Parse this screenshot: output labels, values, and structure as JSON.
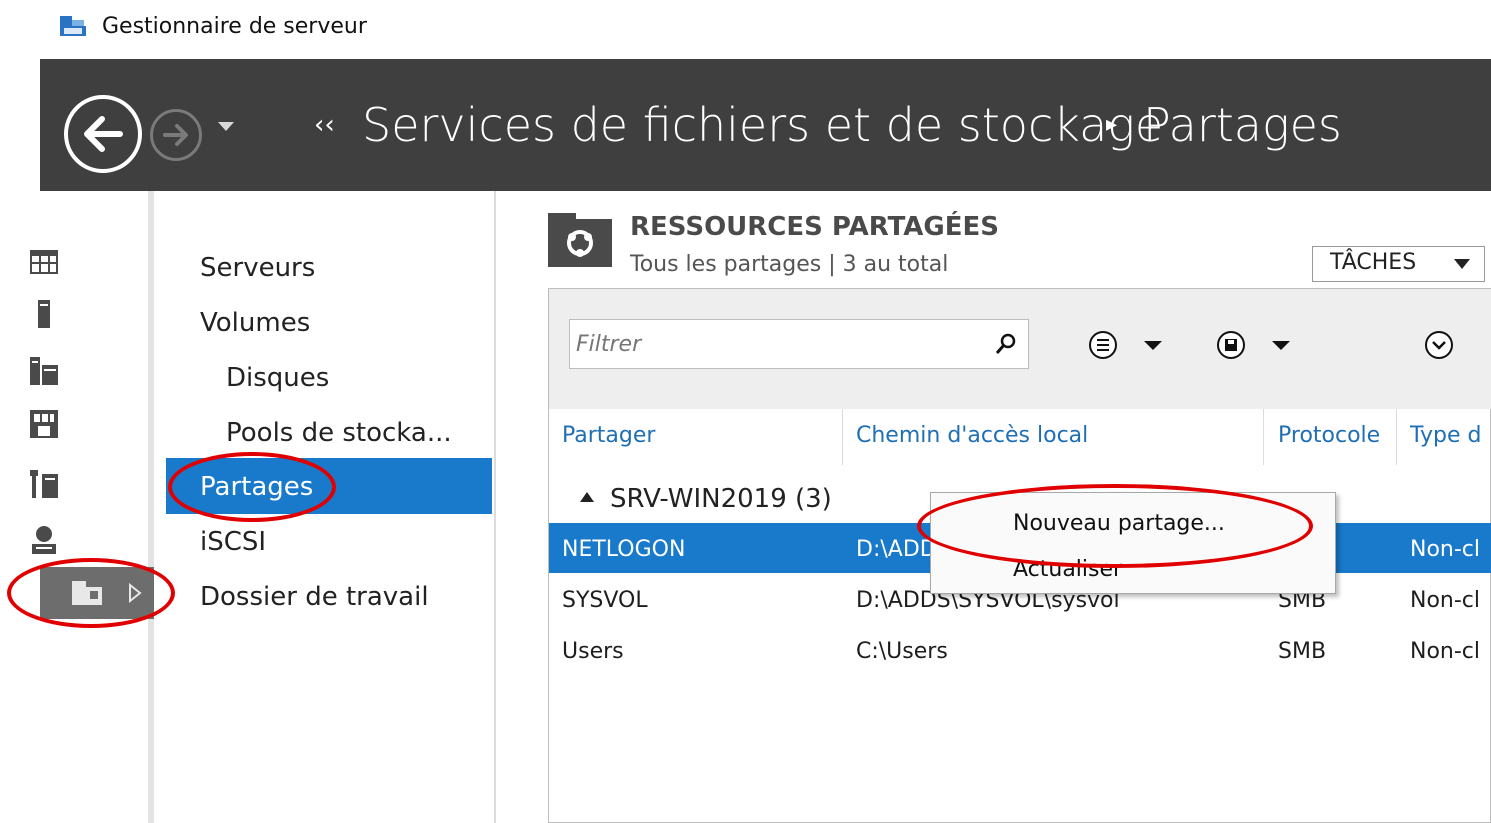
{
  "window": {
    "title": "Gestionnaire de serveur"
  },
  "nav": {
    "breadcrumb_root": "Services de fichiers et de stockage",
    "breadcrumb_current": "Partages"
  },
  "submenu": {
    "items": [
      {
        "label": "Serveurs"
      },
      {
        "label": "Volumes"
      },
      {
        "label": "Disques"
      },
      {
        "label": "Pools de stocka..."
      },
      {
        "label": "Partages"
      },
      {
        "label": "iSCSI"
      },
      {
        "label": "Dossier de travail"
      }
    ]
  },
  "section": {
    "title": "RESSOURCES PARTAGÉES",
    "subtitle": "Tous les partages | 3 au total",
    "tasks_label": "TÂCHES"
  },
  "filter": {
    "placeholder": "Filtrer"
  },
  "table": {
    "columns": [
      "Partager",
      "Chemin d'accès local",
      "Protocole",
      "Type d"
    ],
    "group": "SRV-WIN2019 (3)",
    "rows": [
      {
        "share": "NETLOGON",
        "path": "D:\\ADD",
        "protocol": "",
        "type": "Non-cl"
      },
      {
        "share": "SYSVOL",
        "path": "D:\\ADDS\\SYSVOL\\sysvol",
        "protocol": "SMB",
        "type": "Non-cl"
      },
      {
        "share": "Users",
        "path": "C:\\Users",
        "protocol": "SMB",
        "type": "Non-cl"
      }
    ]
  },
  "context_menu": {
    "items": [
      "Nouveau partage...",
      "Actualiser"
    ]
  },
  "colors": {
    "nav_bg": "#3f3f3f",
    "accent": "#1979ca",
    "header_link": "#1f6fb5",
    "annotation": "#e00000"
  }
}
